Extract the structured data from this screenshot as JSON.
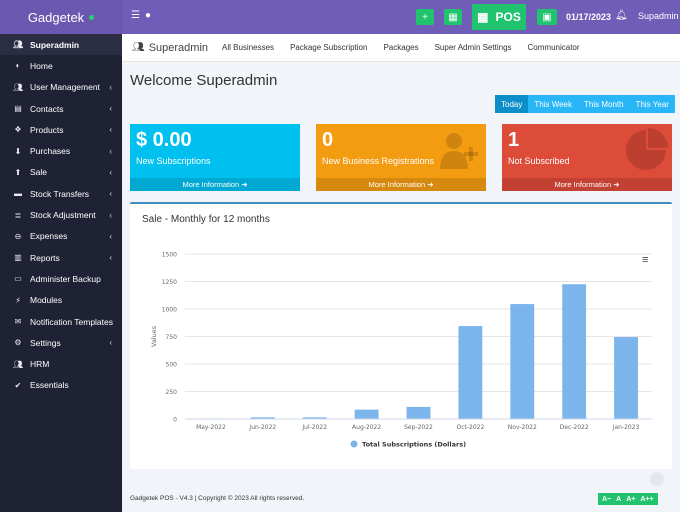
{
  "topbar": {
    "brand": "Gadgetek",
    "pos_label": "POS",
    "date": "01/17/2023",
    "user": "Supadmin"
  },
  "sidebar": {
    "items": [
      {
        "label": "Superadmin",
        "icon": "users-icon",
        "active": true
      },
      {
        "label": "Home",
        "icon": "dashboard-icon"
      },
      {
        "label": "User Management",
        "icon": "users-icon",
        "chevron": true
      },
      {
        "label": "Contacts",
        "icon": "address-book-icon",
        "chevron": true
      },
      {
        "label": "Products",
        "icon": "cubes-icon",
        "chevron": true
      },
      {
        "label": "Purchases",
        "icon": "download-icon",
        "chevron": true
      },
      {
        "label": "Sale",
        "icon": "upload-icon",
        "chevron": true
      },
      {
        "label": "Stock Transfers",
        "icon": "truck-icon",
        "chevron": true
      },
      {
        "label": "Stock Adjustment",
        "icon": "database-icon",
        "chevron": true
      },
      {
        "label": "Expenses",
        "icon": "minus-circle-icon",
        "chevron": true
      },
      {
        "label": "Reports",
        "icon": "chart-icon",
        "chevron": true
      },
      {
        "label": "Administer Backup",
        "icon": "hdd-icon"
      },
      {
        "label": "Modules",
        "icon": "plug-icon"
      },
      {
        "label": "Notification Templates",
        "icon": "envelope-icon"
      },
      {
        "label": "Settings",
        "icon": "cog-icon",
        "chevron": true
      },
      {
        "label": "HRM",
        "icon": "users-icon"
      },
      {
        "label": "Essentials",
        "icon": "check-circle-icon"
      }
    ]
  },
  "nav": {
    "main": "Superadmin",
    "tabs": [
      "All Businesses",
      "Package Subscription",
      "Packages",
      "Super Admin Settings",
      "Communicator"
    ]
  },
  "welcome": "Welcome Superadmin",
  "period": [
    "Today",
    "This Week",
    "This Month",
    "This Year"
  ],
  "cards": [
    {
      "value": "$ 0.00",
      "label": "New Subscriptions",
      "footer": "More Information",
      "color": "#00c0ef"
    },
    {
      "value": "0",
      "label": "New Business Registrations",
      "footer": "More Information",
      "color": "#f39c12"
    },
    {
      "value": "1",
      "label": "Not Subscribed",
      "footer": "More Information",
      "color": "#dd4b39"
    }
  ],
  "chart_title": "Sale - Monthly for 12 months",
  "chart_data": {
    "type": "bar",
    "categories": [
      "May-2022",
      "Jun-2022",
      "Jul-2022",
      "Aug-2022",
      "Sep-2022",
      "Oct-2022",
      "Nov-2022",
      "Dec-2022",
      "Jan-2023"
    ],
    "series": [
      {
        "name": "Total Subscriptions (Dollars)",
        "values": [
          5,
          15,
          15,
          85,
          110,
          845,
          1045,
          1225,
          745
        ]
      }
    ],
    "ylabel": "Values",
    "ylim": [
      0,
      1500
    ],
    "yticks": [
      "0",
      "250",
      "500",
      "750",
      "1000",
      "1250",
      "1500"
    ],
    "color": "#7cb5ec"
  },
  "footer": "Gadgetek POS - V4.3 | Copyright © 2023 All rights reserved.",
  "font_controls": [
    "A−",
    "A",
    "A+",
    "A++"
  ]
}
